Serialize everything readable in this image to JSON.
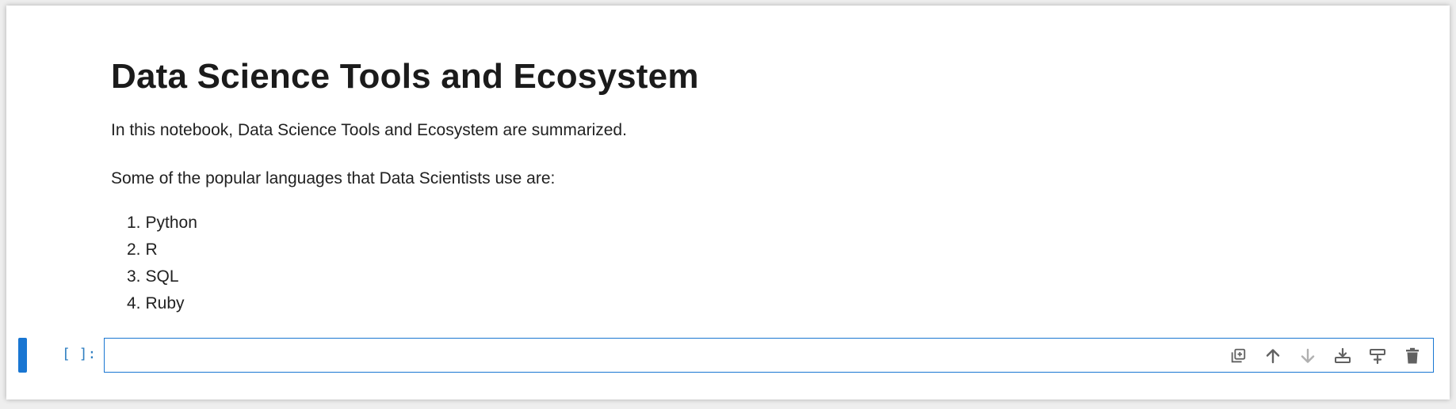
{
  "markdown": {
    "title": "Data Science Tools and Ecosystem",
    "intro": "In this notebook, Data Science Tools and Ecosystem are summarized.",
    "languages_heading": "Some of the popular languages that Data Scientists use are:",
    "languages": [
      {
        "num": "1.",
        "name": "Python"
      },
      {
        "num": "2.",
        "name": "R"
      },
      {
        "num": "3.",
        "name": "SQL"
      },
      {
        "num": "4.",
        "name": "Ruby"
      }
    ]
  },
  "code_cell": {
    "prompt": "[ ]:",
    "value": "",
    "toolbar_icons": [
      "duplicate-icon",
      "move-up-icon",
      "move-down-icon",
      "insert-below-icon",
      "insert-above-icon",
      "delete-icon"
    ]
  },
  "colors": {
    "accent": "#1976d2",
    "prompt": "#307fc1",
    "text": "#212121",
    "icon": "#616161",
    "icon_disabled": "#b0b0b0"
  }
}
